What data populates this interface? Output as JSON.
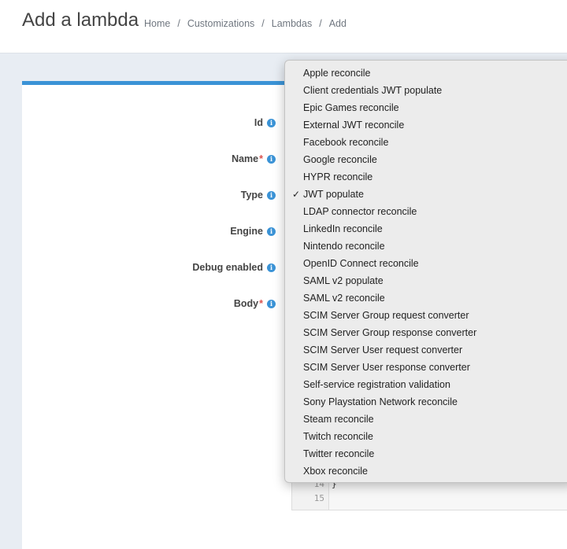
{
  "header": {
    "title": "Add a lambda",
    "breadcrumbs": [
      "Home",
      "Customizations",
      "Lambdas",
      "Add"
    ],
    "separator": "/"
  },
  "form": {
    "fields": [
      {
        "label": "Id",
        "required": false
      },
      {
        "label": "Name",
        "required": true
      },
      {
        "label": "Type",
        "required": false
      },
      {
        "label": "Engine",
        "required": false
      },
      {
        "label": "Debug enabled",
        "required": false
      },
      {
        "label": "Body",
        "required": true
      }
    ],
    "required_marker": "*",
    "info_glyph": "i"
  },
  "editor": {
    "lines": [
      {
        "num": "14",
        "code": "}"
      },
      {
        "num": "15",
        "code": ""
      }
    ]
  },
  "type_dropdown": {
    "selected": "JWT populate",
    "check_glyph": "✓",
    "options": [
      "Apple reconcile",
      "Client credentials JWT populate",
      "Epic Games reconcile",
      "External JWT reconcile",
      "Facebook reconcile",
      "Google reconcile",
      "HYPR reconcile",
      "JWT populate",
      "LDAP connector reconcile",
      "LinkedIn reconcile",
      "Nintendo reconcile",
      "OpenID Connect reconcile",
      "SAML v2 populate",
      "SAML v2 reconcile",
      "SCIM Server Group request converter",
      "SCIM Server Group response converter",
      "SCIM Server User request converter",
      "SCIM Server User response converter",
      "Self-service registration validation",
      "Sony Playstation Network reconcile",
      "Steam reconcile",
      "Twitch reconcile",
      "Twitter reconcile",
      "Xbox reconcile"
    ]
  },
  "colors": {
    "accent": "#3b93d6",
    "required": "#d9534f"
  }
}
